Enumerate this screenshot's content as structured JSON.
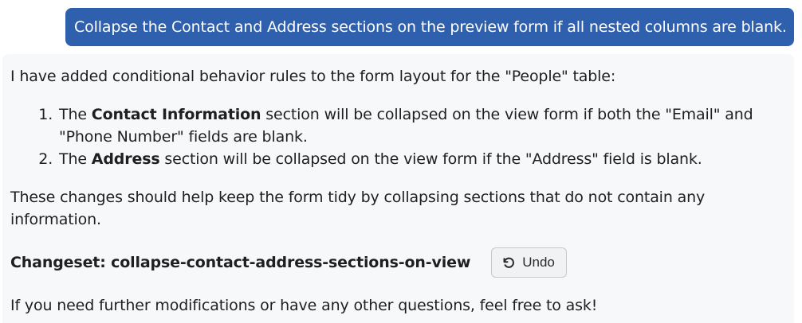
{
  "user_message": {
    "text": "Collapse the Contact and Address sections on the preview form if all nested columns are blank."
  },
  "assistant_message": {
    "intro": "I have added conditional behavior rules to the form layout for the \"People\" table:",
    "rules": [
      {
        "prefix": "The ",
        "bold": "Contact Information",
        "suffix": " section will be collapsed on the view form if both the \"Email\" and \"Phone Number\" fields are blank."
      },
      {
        "prefix": "The ",
        "bold": "Address",
        "suffix": " section will be collapsed on the view form if the \"Address\" field is blank."
      }
    ],
    "summary": "These changes should help keep the form tidy by collapsing sections that do not contain any information.",
    "changeset_label": "Changeset: collapse-contact-address-sections-on-view",
    "undo_label": "Undo",
    "undo_icon": "undo-icon",
    "closing": "If you need further modifications or have any other questions, feel free to ask!"
  },
  "colors": {
    "user_bubble_bg": "#2f60ad",
    "assistant_panel_bg": "#f7f8fa"
  }
}
